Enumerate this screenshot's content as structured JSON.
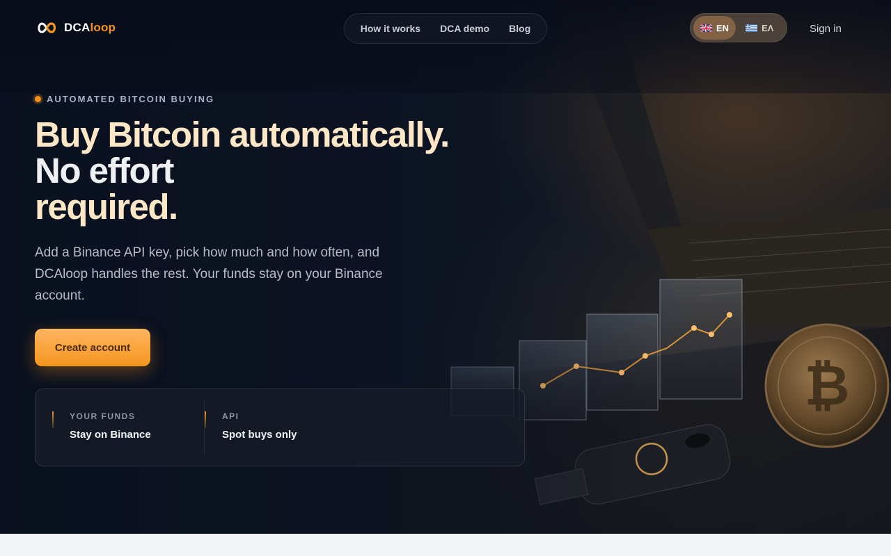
{
  "brand": {
    "name_part1": "DCA",
    "name_part2": "loop"
  },
  "nav": {
    "items": [
      "How it works",
      "DCA demo",
      "Blog"
    ]
  },
  "lang": {
    "en": "EN",
    "el": "ΕΛ"
  },
  "signin": "Sign in",
  "hero": {
    "kicker": "AUTOMATED BITCOIN BUYING",
    "headline_part1": "Buy Bitcoin automatically.",
    "headline_part2": "No effort",
    "headline_part3": "required.",
    "subtext": "Add a Binance API key, pick how much and how often, and DCAloop handles the rest. Your funds stay on your Binance account.",
    "cta": "Create account"
  },
  "facts": [
    {
      "label": "YOUR FUNDS",
      "value": "Stay on Binance"
    },
    {
      "label": "API",
      "value": "Spot buys only"
    }
  ],
  "colors": {
    "accent": "#f7931a",
    "headline_warm": "#fde7c6",
    "background": "#0b1220"
  },
  "icons": {
    "logo": "infinity-loop-icon",
    "flag_en": "uk-flag-icon",
    "flag_el": "greek-flag-icon"
  }
}
